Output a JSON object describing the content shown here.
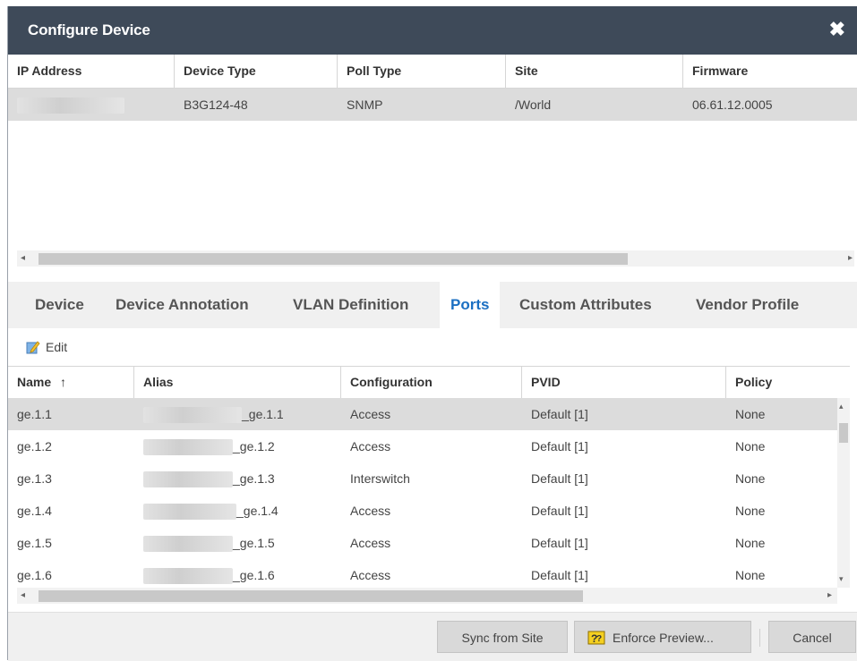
{
  "dialog": {
    "title": "Configure Device",
    "close_icon": "close-icon"
  },
  "device_table": {
    "columns": [
      "IP Address",
      "Device Type",
      "Poll Type",
      "Site",
      "Firmware"
    ],
    "row": {
      "ip_address": "",
      "device_type": "B3G124-48",
      "poll_type": "SNMP",
      "site": "/World",
      "firmware": "06.61.12.0005"
    }
  },
  "tabs": [
    {
      "label": "Device"
    },
    {
      "label": "Device Annotation"
    },
    {
      "label": "VLAN Definition"
    },
    {
      "label": "Ports",
      "active": true
    },
    {
      "label": "Custom Attributes"
    },
    {
      "label": "Vendor Profile"
    }
  ],
  "toolbar": {
    "edit_label": "Edit",
    "edit_icon": "edit-icon"
  },
  "ports_table": {
    "columns": [
      "Name",
      "Alias",
      "Configuration",
      "PVID",
      "Policy"
    ],
    "sort_indicator": "↑",
    "rows": [
      {
        "name": "ge.1.1",
        "alias": "_ge.1.1",
        "configuration": "Access",
        "pvid": "Default [1]",
        "policy": "None"
      },
      {
        "name": "ge.1.2",
        "alias": "_ge.1.2",
        "configuration": "Access",
        "pvid": "Default [1]",
        "policy": "None"
      },
      {
        "name": "ge.1.3",
        "alias": "_ge.1.3",
        "configuration": "Interswitch",
        "pvid": "Default [1]",
        "policy": "None"
      },
      {
        "name": "ge.1.4",
        "alias": "_ge.1.4",
        "configuration": "Access",
        "pvid": "Default [1]",
        "policy": "None"
      },
      {
        "name": "ge.1.5",
        "alias": "_ge.1.5",
        "configuration": "Access",
        "pvid": "Default [1]",
        "policy": "None"
      },
      {
        "name": "ge.1.6",
        "alias": "_ge.1.6",
        "configuration": "Access",
        "pvid": "Default [1]",
        "policy": "None"
      }
    ]
  },
  "footer": {
    "sync_label": "Sync from Site",
    "enforce_label": "Enforce Preview...",
    "enforce_icon": "enforce-icon",
    "cancel_label": "Cancel"
  },
  "colors": {
    "titlebar": "#3e4a59",
    "active_tab": "#1b6fc2",
    "selected_row": "#dcdcdc"
  }
}
